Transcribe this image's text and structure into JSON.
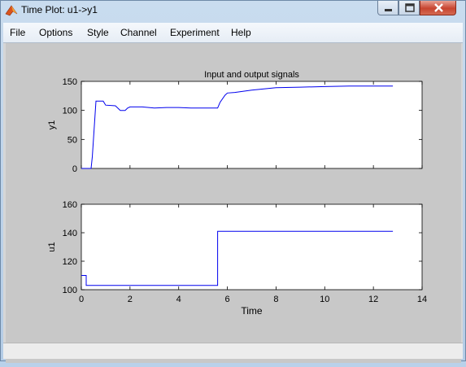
{
  "window": {
    "title": "Time Plot: u1->y1"
  },
  "menu": {
    "items": [
      {
        "label": "File"
      },
      {
        "label": "Options"
      },
      {
        "label": "Style"
      },
      {
        "label": "Channel"
      },
      {
        "label": "Experiment"
      },
      {
        "label": "Help"
      }
    ]
  },
  "colors": {
    "signal": "#0000ee",
    "figure_bg": "#c8c8c8",
    "axes_bg": "#ffffff"
  },
  "chart_data": [
    {
      "type": "line",
      "title": "Input and output signals",
      "xlabel": "",
      "ylabel": "y1",
      "xlim": [
        0,
        14
      ],
      "ylim": [
        0,
        150
      ],
      "xticks": [],
      "yticks": [
        0,
        50,
        100,
        150
      ],
      "series": [
        {
          "x": [
            0,
            0.4,
            0.45,
            0.6,
            0.9,
            1.0,
            1.4,
            1.6,
            1.8,
            1.9,
            2.0,
            2.5,
            3.0,
            3.5,
            4.0,
            4.5,
            5.0,
            5.6,
            5.7,
            5.9,
            6.0,
            6.3,
            7.0,
            7.5,
            8.0,
            9.0,
            10.0,
            11.0,
            12.0,
            12.8
          ],
          "y": [
            0,
            0,
            20,
            116,
            116,
            109,
            108,
            100,
            100,
            104,
            106,
            106,
            104,
            105,
            105,
            104,
            104,
            104,
            114,
            126,
            130,
            131,
            135,
            137,
            139,
            140,
            141,
            142,
            142,
            142
          ]
        }
      ]
    },
    {
      "type": "line",
      "title": "",
      "xlabel": "Time",
      "ylabel": "u1",
      "xlim": [
        0,
        14
      ],
      "ylim": [
        100,
        160
      ],
      "xticks": [
        0,
        2,
        4,
        6,
        8,
        10,
        12,
        14
      ],
      "yticks": [
        100,
        120,
        140,
        160
      ],
      "series": [
        {
          "x": [
            0,
            0.2,
            0.2,
            5.6,
            5.6,
            12.8
          ],
          "y": [
            110,
            110,
            103,
            103,
            141,
            141
          ]
        }
      ]
    }
  ]
}
